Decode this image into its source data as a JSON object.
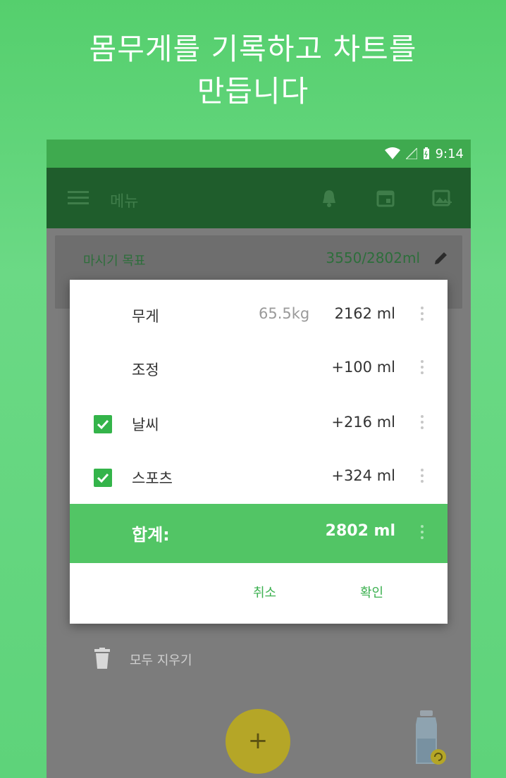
{
  "promo": {
    "line1": "몸무게를 기록하고 차트를",
    "line2": "만듭니다"
  },
  "status_bar": {
    "time": "9:14"
  },
  "toolbar": {
    "title": "메뉴",
    "icons": [
      "menu-icon",
      "bell-icon",
      "calendar-icon",
      "image-icon"
    ]
  },
  "goal_card": {
    "label": "마시기 목표",
    "value": "3550/2802ml"
  },
  "dialog": {
    "rows": [
      {
        "name": "무게",
        "extra": "65.5kg",
        "amount": "2162 ml",
        "checked": false
      },
      {
        "name": "조정",
        "extra": "",
        "amount": "+100 ml",
        "checked": false
      },
      {
        "name": "날씨",
        "extra": "",
        "amount": "+216 ml",
        "checked": true
      },
      {
        "name": "스포츠",
        "extra": "",
        "amount": "+324 ml",
        "checked": true
      }
    ],
    "total": {
      "name": "합계:",
      "amount": "2802 ml"
    },
    "cancel_label": "취소",
    "confirm_label": "확인"
  },
  "clear_all": {
    "label": "모두 지우기"
  },
  "fab": {
    "symbol": "+"
  },
  "colors": {
    "accent": "#34b44a",
    "toolbar": "#1f5d2c",
    "status_bar": "#3faa4f",
    "fab": "#b5a627"
  }
}
